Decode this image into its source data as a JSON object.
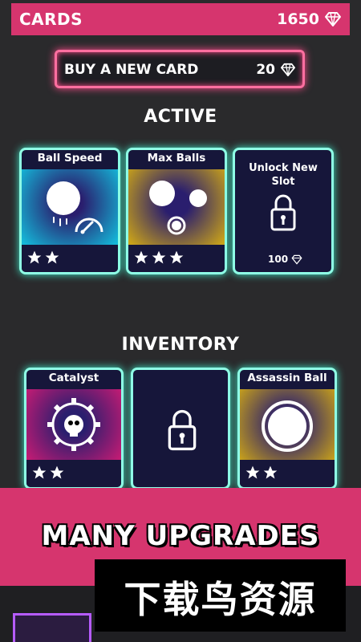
{
  "header": {
    "title": "CARDS",
    "gems": "1650",
    "gem_icon": "diamond-icon"
  },
  "buy": {
    "label": "BUY A NEW CARD",
    "price": "20"
  },
  "sections": {
    "active": "ACTIVE",
    "inventory": "INVENTORY"
  },
  "active_cards": [
    {
      "title": "Ball Speed",
      "stars": 2,
      "icon": "ball-speed-icon"
    },
    {
      "title": "Max Balls",
      "stars": 3,
      "icon": "max-balls-icon"
    },
    {
      "title": "Unlock New Slot",
      "price": "100",
      "icon": "lock-icon"
    }
  ],
  "inventory_cards": [
    {
      "title": "Catalyst",
      "stars": 2,
      "icon": "gear-skull-icon"
    },
    {
      "title": "",
      "icon": "lock-icon"
    },
    {
      "title": "Assassin Ball",
      "stars": 2,
      "icon": "ring-icon"
    }
  ],
  "banner": {
    "text": "MANY UPGRADES"
  },
  "watermark": {
    "text": "下载鸟资源"
  },
  "colors": {
    "pink": "#d6356e",
    "teal": "#8fffe6",
    "cyan_art": "#1ac9e8",
    "gold_art": "#c9a21a",
    "magenta_art": "#c81b74"
  }
}
